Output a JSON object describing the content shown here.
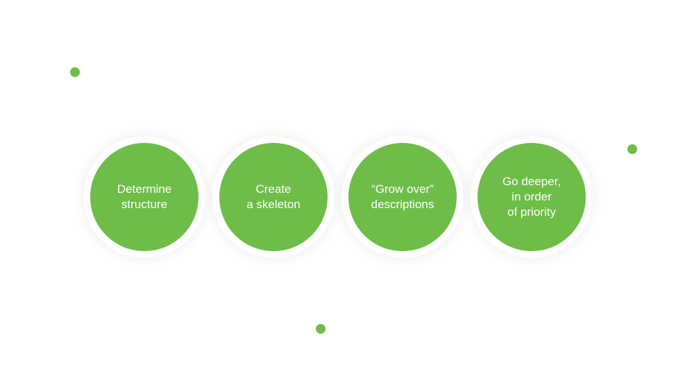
{
  "colors": {
    "accent": "#6dbd48",
    "background": "#ffffff",
    "text": "#ffffff"
  },
  "steps": [
    {
      "lines": [
        "Determine",
        "structure"
      ]
    },
    {
      "lines": [
        "Create",
        "a skeleton"
      ]
    },
    {
      "lines": [
        "“Grow over”",
        "descriptions"
      ]
    },
    {
      "lines": [
        "Go deeper,",
        "in order",
        "of priority"
      ]
    }
  ]
}
